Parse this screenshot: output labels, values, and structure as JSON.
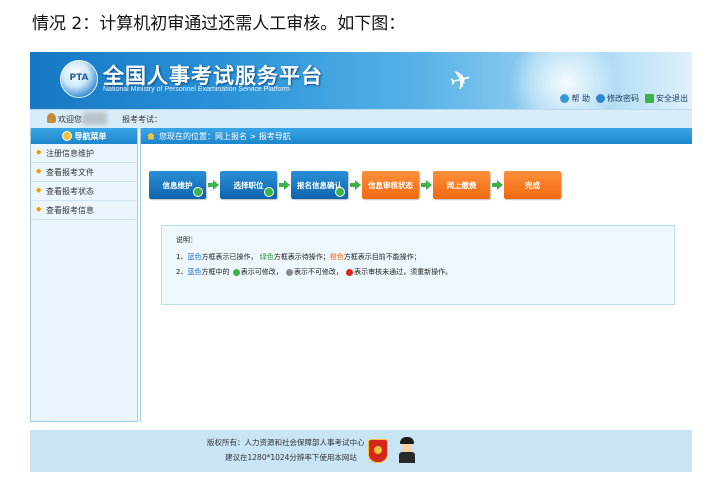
{
  "heading": "情况 2：计算机初审通过还需人工审核。如下图：",
  "banner": {
    "logo_text": "PTA",
    "title": "全国人事考试服务平台",
    "subtitle": "National Ministry of Personnel Examination Service Platform",
    "links": [
      "帮 助",
      "修改密码",
      "安全退出"
    ]
  },
  "welcome_bar": {
    "welcome": "欢迎您：",
    "exam": "报考考试："
  },
  "sidebar": {
    "title": "导航菜单",
    "items": [
      "注册信息维护",
      "查看报考文件",
      "查看报考状态",
      "查看报考信息"
    ]
  },
  "breadcrumb": "您现在的位置：网上报名 > 报考导航",
  "steps": [
    {
      "label": "信息维护",
      "color": "blue",
      "check": true
    },
    {
      "label": "选择职位",
      "color": "blue",
      "check": true
    },
    {
      "label": "报名信息确认",
      "color": "blue",
      "check": true
    },
    {
      "label": "信息审核状态",
      "color": "orange",
      "check": false
    },
    {
      "label": "网上缴费",
      "color": "orange",
      "check": false
    },
    {
      "label": "完成",
      "color": "orange",
      "check": false
    }
  ],
  "note": {
    "title": "说明：",
    "line1": {
      "prefix": "1、",
      "blue": "蓝色",
      "t1": "方框表示已操作，",
      "green": "绿色",
      "t2": "方框表示待操作；",
      "orange": "橙色",
      "t3": "方框表示目前不能操作；"
    },
    "line2": {
      "prefix": "2、",
      "blue": "蓝色",
      "t1": "方框中的",
      "t2": "表示可修改，",
      "t3": "表示不可修改，",
      "t4": "表示审核未通过，须重新操作。"
    }
  },
  "footer": {
    "line1": "版权所有：人力资源和社会保障部人事考试中心",
    "line2": "建议在1280*1024分辨率下使用本网站"
  },
  "colors": {
    "step_blue": "#0f63ad",
    "step_orange": "#f06a10",
    "nav_blue": "#1e86cc"
  }
}
